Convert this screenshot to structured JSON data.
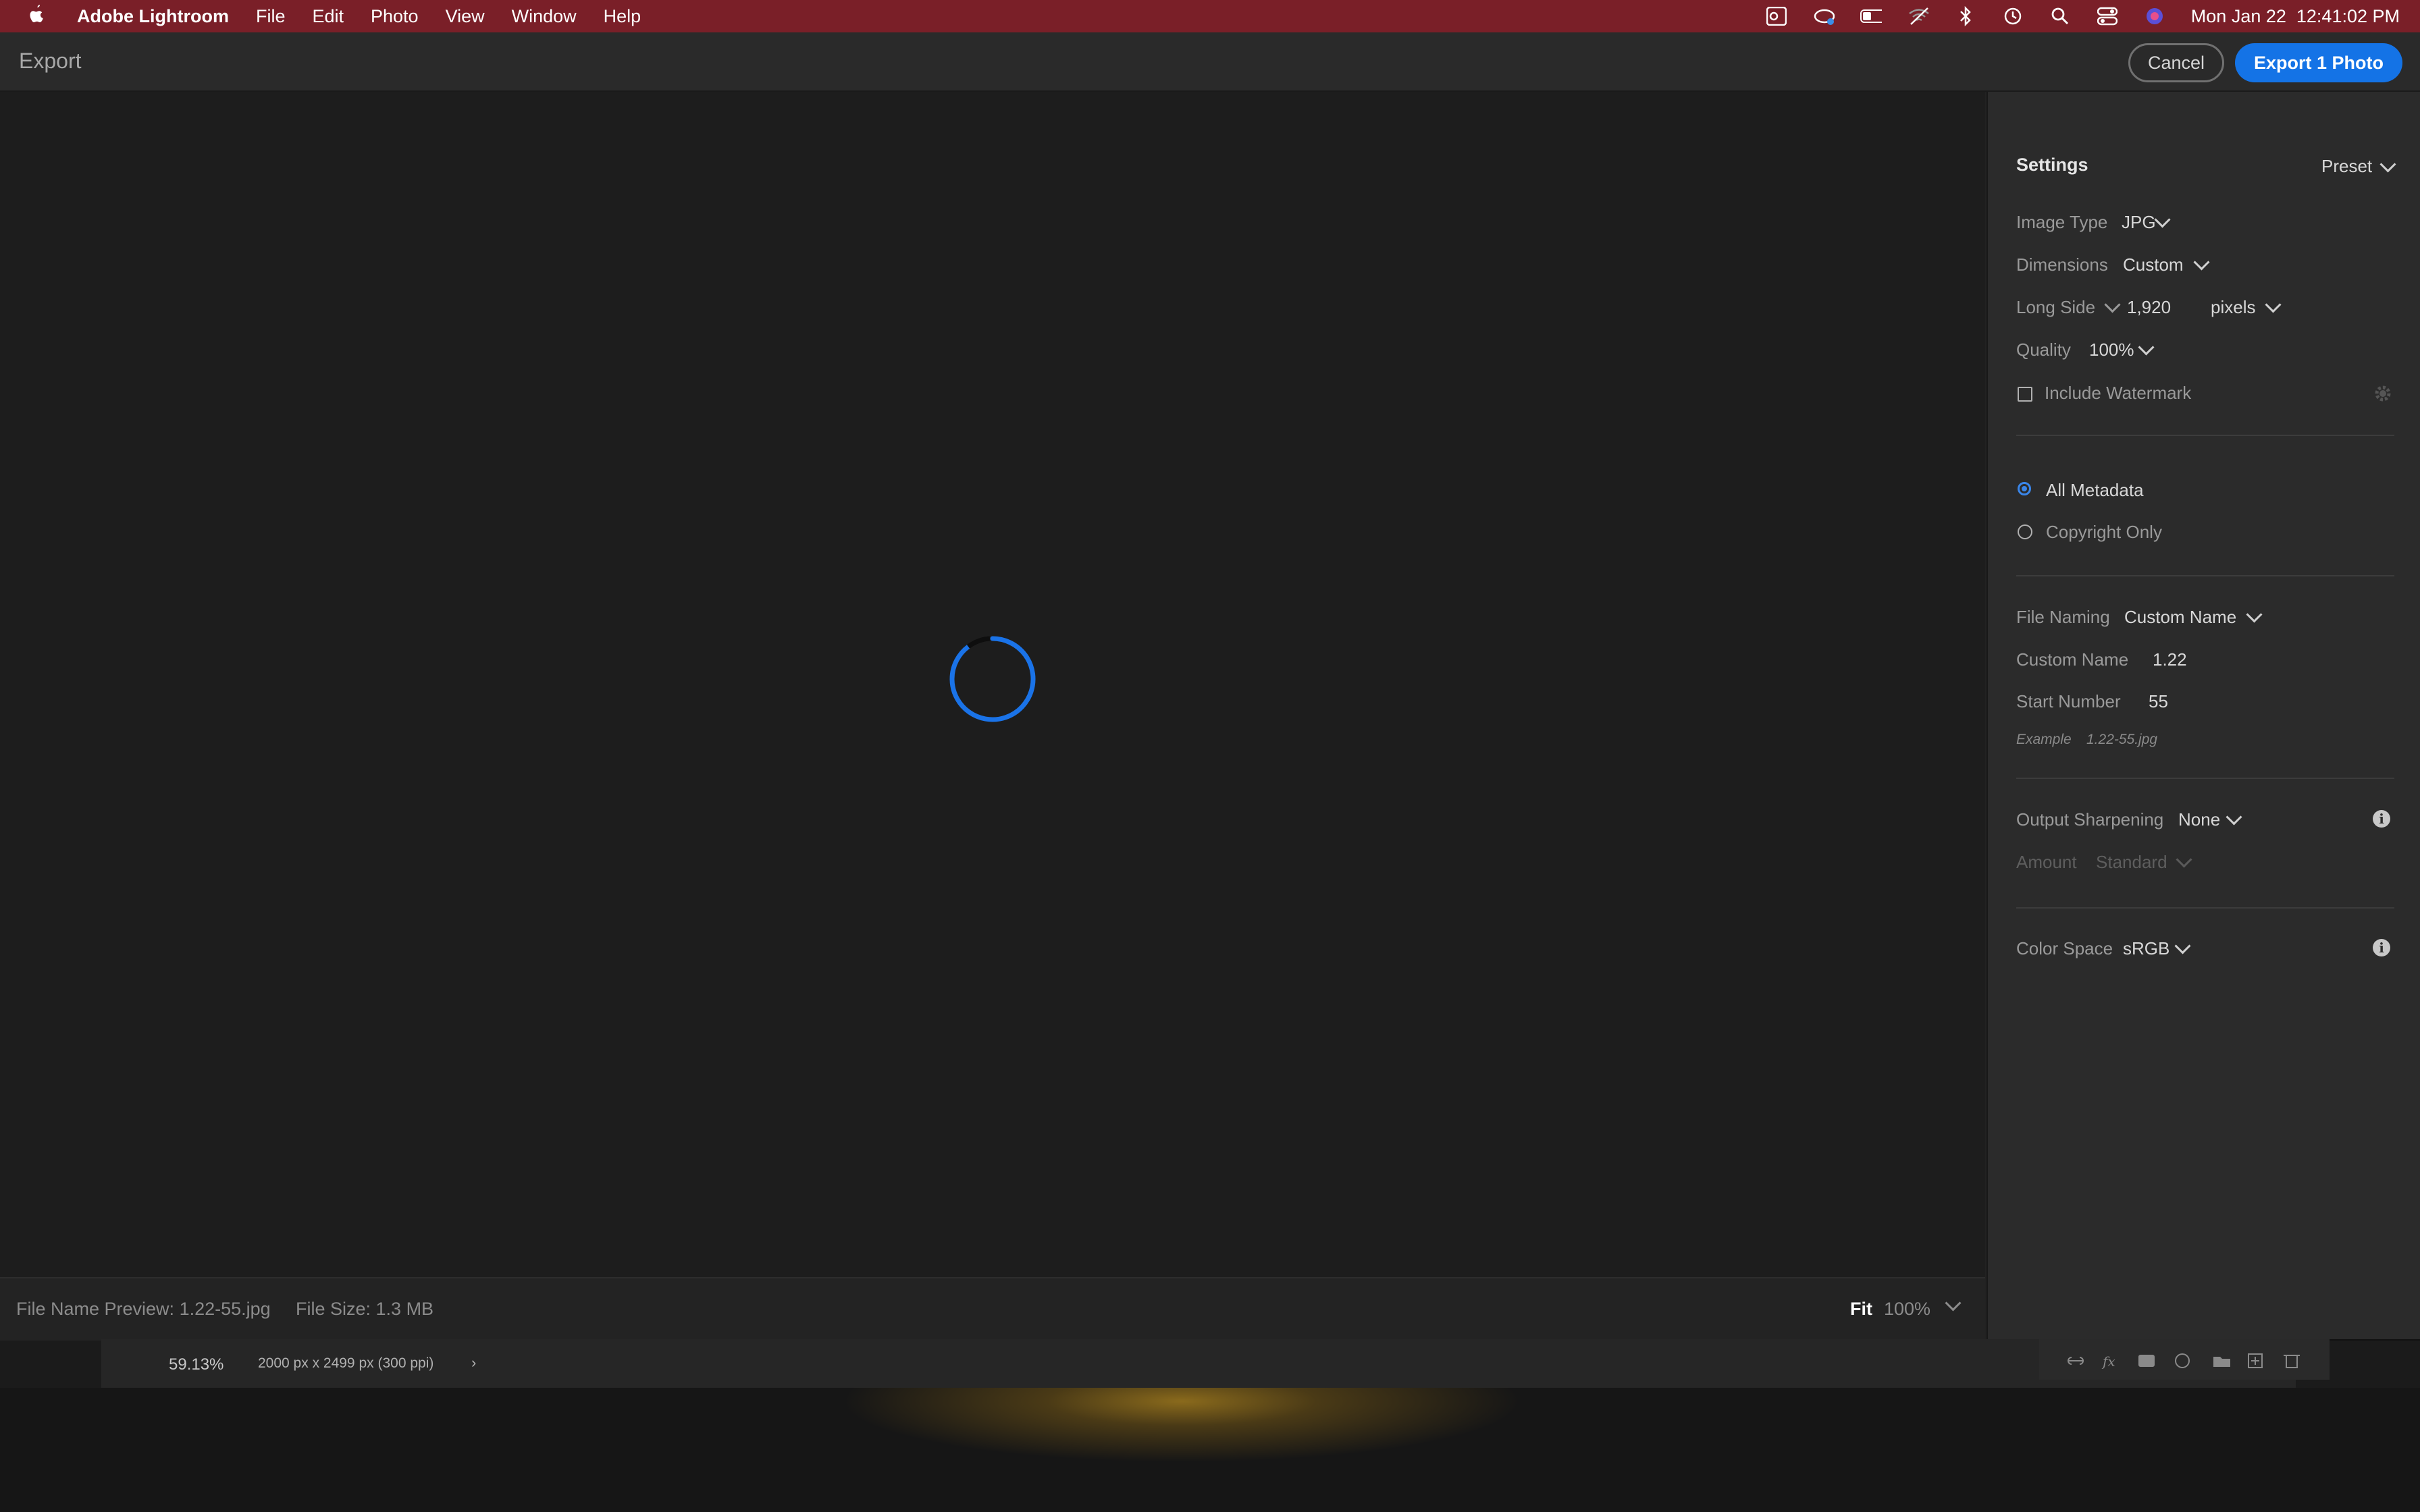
{
  "menubar": {
    "app_name": "Adobe Lightroom",
    "items": [
      "File",
      "Edit",
      "Photo",
      "View",
      "Window",
      "Help"
    ],
    "clock": "Mon Jan 22  12:41:02 PM"
  },
  "window": {
    "title": "Export",
    "cancel_label": "Cancel",
    "export_label": "Export 1 Photo"
  },
  "status": {
    "file_name_preview": "File Name Preview: 1.22-55.jpg",
    "file_size": "File Size: 1.3 MB",
    "fit_label": "Fit",
    "zoom": "100%"
  },
  "settings": {
    "heading": "Settings",
    "preset_label": "Preset",
    "image_type_label": "Image Type",
    "image_type_value": "JPG",
    "dimensions_label": "Dimensions",
    "dimensions_value": "Custom",
    "long_side_label": "Long Side",
    "long_side_value": "1,920",
    "long_side_unit": "pixels",
    "quality_label": "Quality",
    "quality_value": "100%",
    "watermark_label": "Include Watermark",
    "watermark_checked": false,
    "metadata_all_label": "All Metadata",
    "metadata_copyright_label": "Copyright Only",
    "metadata_selected": "All Metadata",
    "file_naming_label": "File Naming",
    "file_naming_value": "Custom Name",
    "custom_name_label": "Custom Name",
    "custom_name_value": "1.22",
    "start_number_label": "Start Number",
    "start_number_value": "55",
    "example_label": "Example",
    "example_value": "1.22-55.jpg",
    "output_sharpening_label": "Output Sharpening",
    "output_sharpening_value": "None",
    "amount_label": "Amount",
    "amount_value": "Standard",
    "color_space_label": "Color Space",
    "color_space_value": "sRGB"
  },
  "background": {
    "zoom_readout": "59.13%",
    "dimensions_readout": "2000 px x 2499 px (300 ppi)"
  },
  "colors": {
    "menubar": "#7a1f28",
    "accent": "#1473e6"
  }
}
